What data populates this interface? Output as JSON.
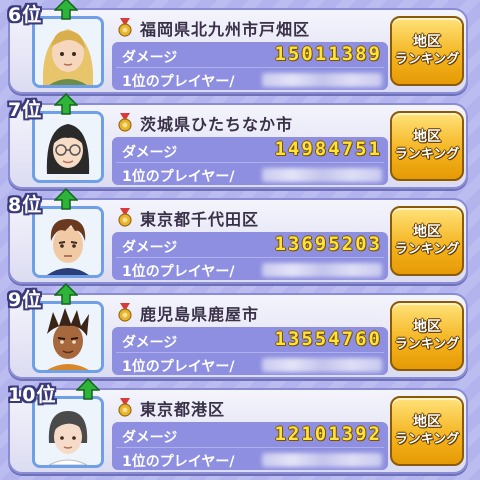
{
  "list": {
    "damage_label": "ダメージ",
    "player_label": "1位のプレイヤー/",
    "button_line1": "地区",
    "button_line2": "ランキング",
    "entries": [
      {
        "rank": "6位",
        "region": "福岡県北九州市戸畑区",
        "damage": "15011389",
        "avatar": "avatar-blonde-girl",
        "accent": "#e8c46a"
      },
      {
        "rank": "7位",
        "region": "茨城県ひたちなか市",
        "damage": "14984751",
        "avatar": "avatar-glasses-girl",
        "accent": "#2a2a2a"
      },
      {
        "rank": "8位",
        "region": "東京都千代田区",
        "damage": "13695203",
        "avatar": "avatar-brown-hair-boy",
        "accent": "#6b3a1e"
      },
      {
        "rank": "9位",
        "region": "鹿児島県鹿屋市",
        "damage": "13554760",
        "avatar": "avatar-dreadlock-boy",
        "accent": "#3a2418"
      },
      {
        "rank": "10位",
        "region": "東京都港区",
        "damage": "12101392",
        "avatar": "avatar-short-hair-woman",
        "accent": "#4a4a4a"
      }
    ]
  },
  "colors": {
    "background": "#b3b4ee",
    "panel": "#8e8fe0",
    "damage_value": "#ffe23a",
    "button": "#f3b21b",
    "up_arrow": "#2fb43a"
  }
}
